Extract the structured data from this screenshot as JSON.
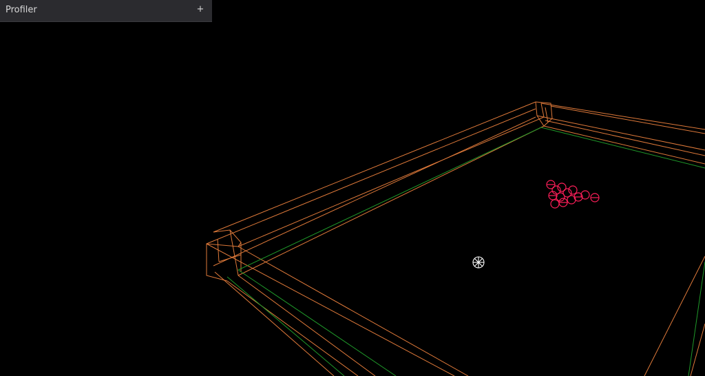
{
  "profiler_panel": {
    "title": "Profiler",
    "add_label": "+"
  },
  "scene": {
    "colors": {
      "background": "#000000",
      "wall_wireframe": "#e07a3a",
      "floor_edge": "#1f9a2a",
      "ball_cluster": "#ff1f5a",
      "cue_object": "#ffffff"
    }
  }
}
